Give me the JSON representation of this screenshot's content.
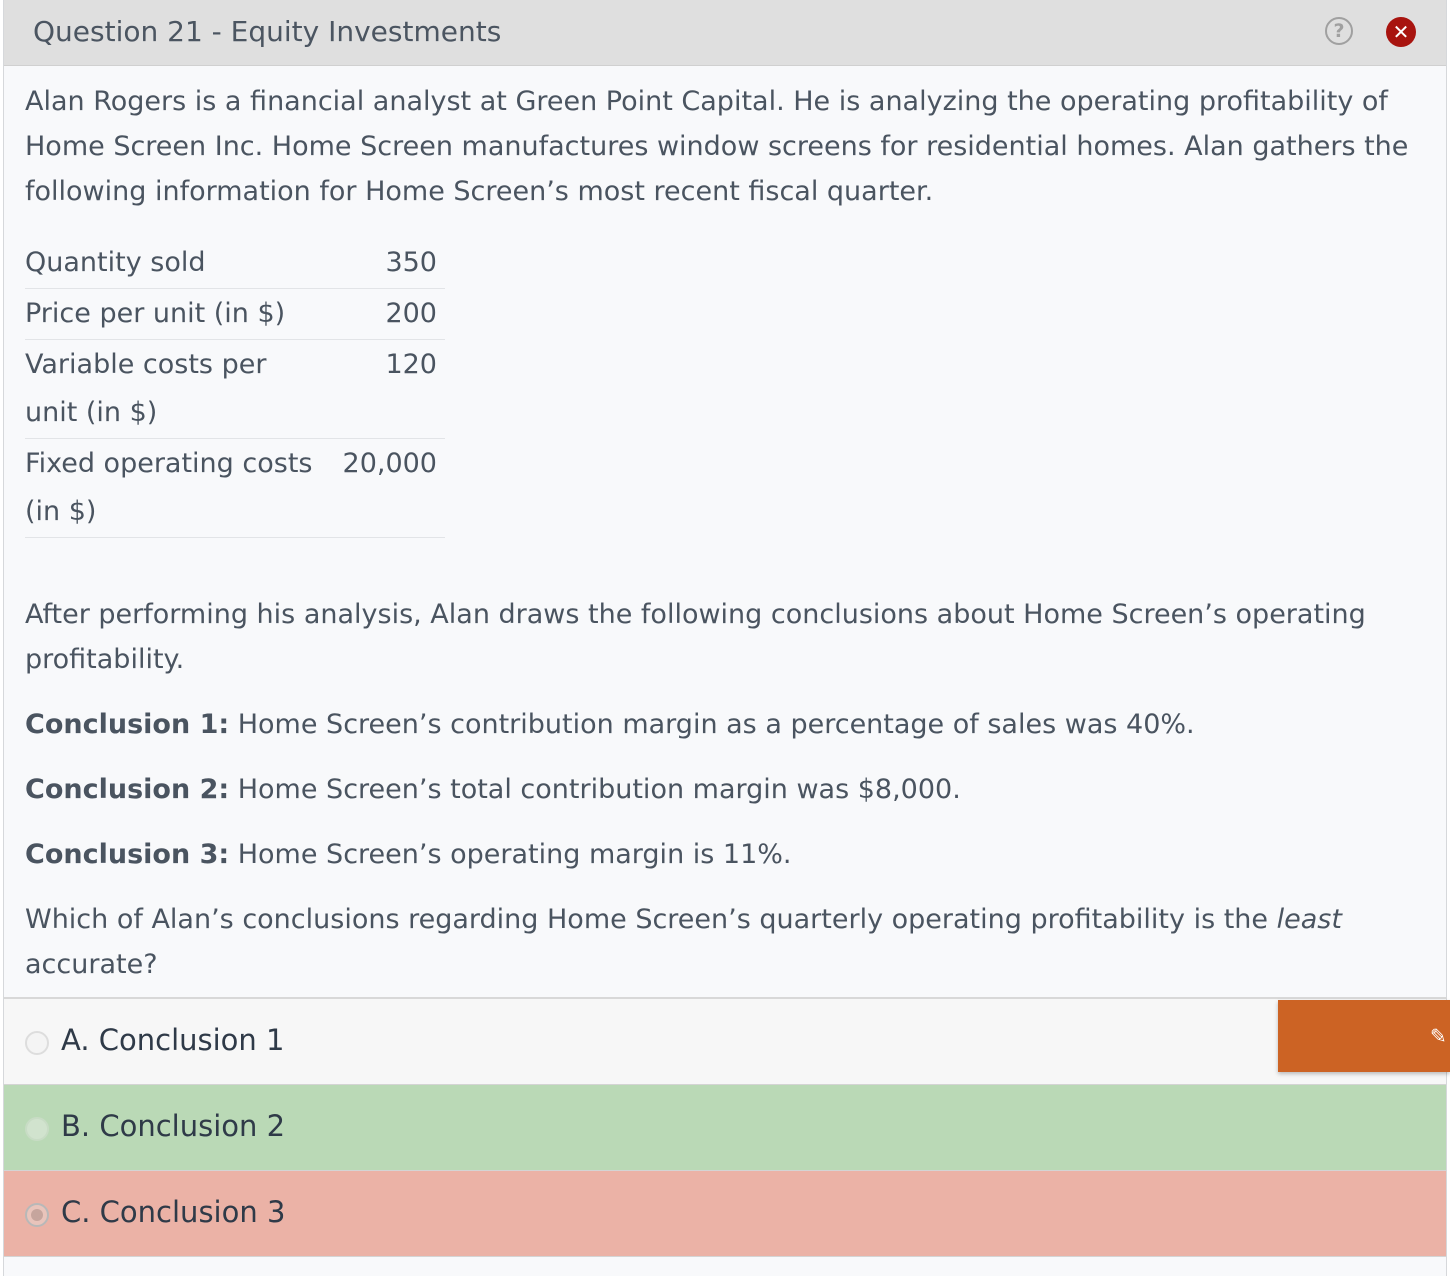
{
  "header": {
    "title": "Question 21 - Equity Investments",
    "help_icon": "question-circle-icon",
    "close_icon": "close-x-icon",
    "help_glyph": "?",
    "close_glyph": "✕"
  },
  "question": {
    "intro": "Alan Rogers is a financial analyst at Green Point Capital.  He is analyzing the operating profitability of Home Screen Inc.  Home Screen manufactures window screens for residential homes.  Alan gathers the following information for Home Screen’s most recent fiscal quarter.",
    "table": [
      {
        "label": "Quantity sold",
        "value": "350"
      },
      {
        "label": "Price per unit (in $)",
        "value": "200"
      },
      {
        "label": "Variable costs per unit (in $)",
        "value": "120"
      },
      {
        "label": "Fixed operating costs (in $)",
        "value": "20,000"
      }
    ],
    "after": "After performing his analysis, Alan draws the following conclusions about Home Screen’s operating profitability.",
    "conclusions": [
      {
        "label": "Conclusion 1:",
        "text": " Home Screen’s contribution margin as a percentage of sales was 40%."
      },
      {
        "label": "Conclusion 2:",
        "text": " Home Screen’s total contribution margin was $8,000."
      },
      {
        "label": "Conclusion 3:",
        "text": " Home Screen’s operating margin is 11%."
      }
    ],
    "prompt_start": "Which of Alan’s conclusions regarding Home Screen’s quarterly operating profitability is the ",
    "prompt_emphasis": "least",
    "prompt_end": " accurate?"
  },
  "answers": [
    {
      "label": "A. Conclusion 1",
      "state": "neutral",
      "color": "#f7f7f7"
    },
    {
      "label": "B. Conclusion 2",
      "state": "correct",
      "color": "#bad9b6"
    },
    {
      "label": "C. Conclusion 3",
      "state": "selected-incorrect",
      "color": "#ebb2a6"
    }
  ],
  "side_button": {
    "color": "#cc6324",
    "icon": "pencil-icon",
    "glyph": "✎"
  }
}
